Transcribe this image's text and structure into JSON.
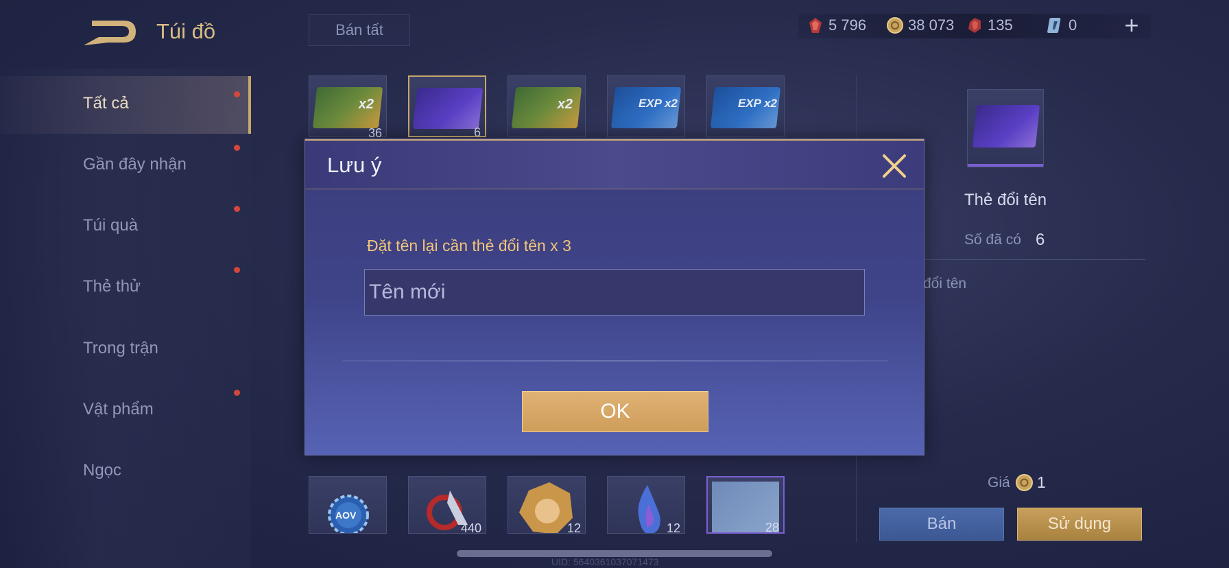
{
  "header": {
    "title": "Túi đồ",
    "sell_all_label": "Bán tất",
    "currencies": [
      {
        "icon": "red-gem-icon",
        "value": "5 796"
      },
      {
        "icon": "gold-coin-icon",
        "value": "38 073"
      },
      {
        "icon": "red-ruby-icon",
        "value": "135"
      },
      {
        "icon": "blue-card-icon",
        "value": "0"
      }
    ],
    "add_label": "+"
  },
  "sidebar": {
    "items": [
      {
        "label": "Tất cả",
        "active": true,
        "dot": true
      },
      {
        "label": "Gần đây nhận",
        "dot": true
      },
      {
        "label": "Túi quà",
        "dot": true
      },
      {
        "label": "Thẻ thử",
        "dot": true
      },
      {
        "label": "Trong trận",
        "dot": false
      },
      {
        "label": "Vật phẩm",
        "dot": true
      },
      {
        "label": "Ngọc",
        "dot": false
      }
    ]
  },
  "grid": {
    "top_row": [
      {
        "name": "gold-x2-card",
        "tag": "x2",
        "count": "36"
      },
      {
        "name": "rename-card",
        "tag": "",
        "count": "6"
      },
      {
        "name": "gold-x2-card",
        "tag": "x2",
        "count": ""
      },
      {
        "name": "exp-x2-card",
        "tag": "EXP x2",
        "count": ""
      },
      {
        "name": "exp-x2-card",
        "tag": "EXP x2",
        "count": ""
      }
    ],
    "bottom_row": [
      {
        "name": "aov-chip",
        "label": "AOV",
        "count": ""
      },
      {
        "name": "red-emblem",
        "count": "440"
      },
      {
        "name": "hero-portrait",
        "count": "12"
      },
      {
        "name": "blue-flame",
        "count": "12"
      },
      {
        "name": "diamond-card",
        "count": "28"
      }
    ]
  },
  "detail": {
    "name": "Thẻ đổi tên",
    "owned_label": "Số đã có",
    "owned_value": "6",
    "description": "đổi tên",
    "price_label": "Giá",
    "price_value": "1",
    "sell_label": "Bán",
    "use_label": "Sử dụng"
  },
  "footer": {
    "uid": "UID: 5640361037071473"
  },
  "modal": {
    "title": "Lưu ý",
    "message": "Đặt tên lại cần thẻ đổi tên x 3",
    "input_placeholder": "Tên mới",
    "ok_label": "OK"
  },
  "colors": {
    "accent_gold": "#c8a76b",
    "modal_text_gold": "#f1c57a",
    "notification_dot": "#d2473b"
  }
}
